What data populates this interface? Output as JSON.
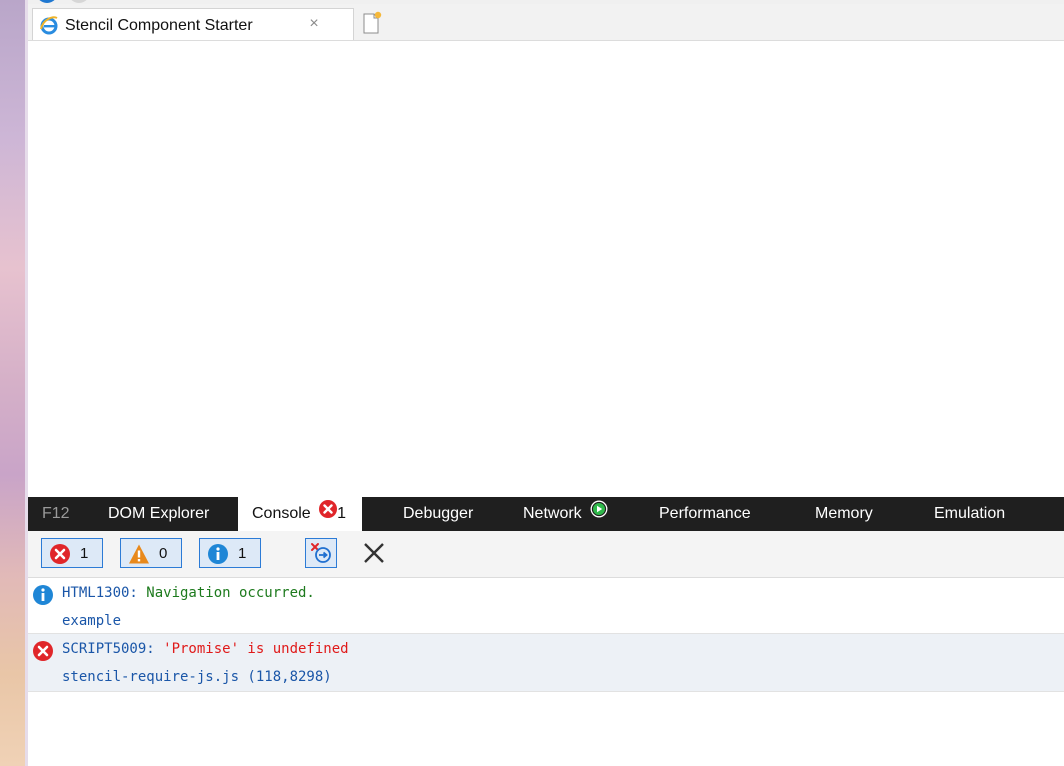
{
  "browser": {
    "tab_title": "Stencil Component Starter",
    "tab_close": "×"
  },
  "devtools": {
    "tabs": [
      {
        "label": "F12"
      },
      {
        "label": "DOM Explorer"
      },
      {
        "label": "Console",
        "badge_count": "1"
      },
      {
        "label": "Debugger"
      },
      {
        "label": "Network"
      },
      {
        "label": "Performance"
      },
      {
        "label": "Memory"
      },
      {
        "label": "Emulation"
      }
    ],
    "filters": {
      "errors": "1",
      "warnings": "0",
      "messages": "1"
    }
  },
  "console": {
    "messages": [
      {
        "type": "info",
        "code": "HTML1300:",
        "text": " Navigation occurred.",
        "source": "example"
      },
      {
        "type": "error",
        "code": "SCRIPT5009:",
        "text": " 'Promise' is undefined",
        "source": "stencil-require-js.js (118,8298)"
      }
    ]
  },
  "colors": {
    "devtools_bar": "#1f1f1f",
    "error_red": "#e0262a",
    "warning_orange": "#e8891c",
    "info_blue": "#1f86d6",
    "link_blue": "#1a56a8",
    "info_green": "#1d7a1d"
  }
}
